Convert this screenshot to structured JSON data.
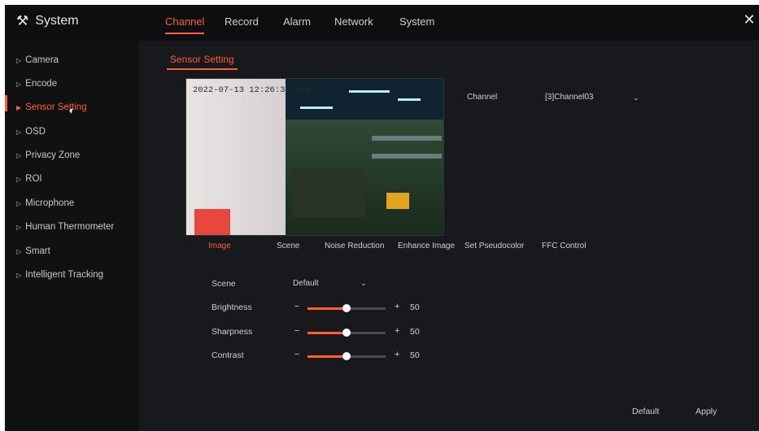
{
  "header": {
    "title": "System",
    "tabs": [
      {
        "label": "Channel",
        "active": true
      },
      {
        "label": "Record"
      },
      {
        "label": "Alarm"
      },
      {
        "label": "Network"
      },
      {
        "label": "System"
      }
    ],
    "close_glyph": "✕"
  },
  "sidebar": {
    "items": [
      {
        "label": "Camera"
      },
      {
        "label": "Encode"
      },
      {
        "label": "Sensor Setting",
        "active": true
      },
      {
        "label": "OSD"
      },
      {
        "label": "Privacy Zone"
      },
      {
        "label": "ROI"
      },
      {
        "label": "Microphone"
      },
      {
        "label": "Human Thermometer"
      },
      {
        "label": "Smart"
      },
      {
        "label": "Intelligent Tracking"
      }
    ]
  },
  "main": {
    "section_title": "Sensor Setting",
    "video": {
      "timestamp": "2022-07-13 12:26:35 Wed"
    },
    "channel": {
      "label": "Channel",
      "value": "[3]Channel03"
    },
    "subtabs": [
      {
        "label": "Image",
        "active": true
      },
      {
        "label": "Scene"
      },
      {
        "label": "Noise Reduction"
      },
      {
        "label": "Enhance Image"
      },
      {
        "label": "Set Pseudocolor"
      },
      {
        "label": "FFC Control"
      }
    ],
    "scene": {
      "label": "Scene",
      "value": "Default"
    },
    "sliders": [
      {
        "label": "Brightness",
        "value": 50,
        "minus": "−",
        "plus": "+"
      },
      {
        "label": "Sharpness",
        "value": 50,
        "minus": "−",
        "plus": "+"
      },
      {
        "label": "Contrast",
        "value": 50,
        "minus": "−",
        "plus": "+"
      }
    ]
  },
  "footer": {
    "default_label": "Default",
    "apply_label": "Apply"
  },
  "colors": {
    "accent": "#ff5f2e",
    "background": "#18191c",
    "sidebar": "#101113",
    "topbar": "#0d0e10"
  },
  "icons": {
    "logo": "tools-icon",
    "close": "close-icon",
    "dropdown": "chevron-down-icon",
    "nav": "triangle-right-icon"
  }
}
